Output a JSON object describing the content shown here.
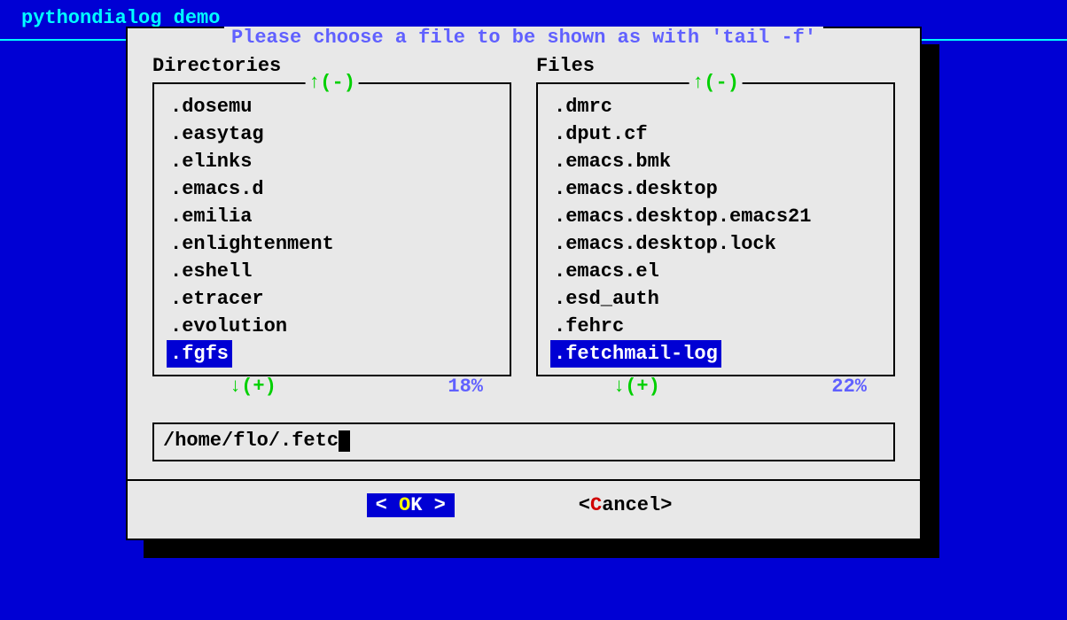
{
  "app_title": "pythondialog demo",
  "dialog": {
    "title": "Please choose a file to be shown as with 'tail -f'",
    "directories": {
      "label": "Directories",
      "scroll_up": "↑(-)",
      "scroll_down": "↓(+)",
      "scroll_pct": "18%",
      "items": [
        ".dosemu",
        ".easytag",
        ".elinks",
        ".emacs.d",
        ".emilia",
        ".enlightenment",
        ".eshell",
        ".etracer",
        ".evolution",
        ".fgfs"
      ],
      "selected_index": 9
    },
    "files": {
      "label": "Files",
      "scroll_up": "↑(-)",
      "scroll_down": "↓(+)",
      "scroll_pct": "22%",
      "items": [
        ".dmrc",
        ".dput.cf",
        ".emacs.bmk",
        ".emacs.desktop",
        ".emacs.desktop.emacs21",
        ".emacs.desktop.lock",
        ".emacs.el",
        ".esd_auth",
        ".fehrc",
        ".fetchmail-log"
      ],
      "selected_index": 9
    },
    "path_value": "/home/flo/.fetc",
    "buttons": {
      "ok_bracket_l": "<  ",
      "ok_hotkey": "O",
      "ok_rest": "K  >",
      "cancel_bracket_l": "<",
      "cancel_hotkey": "C",
      "cancel_rest": "ancel>"
    }
  }
}
